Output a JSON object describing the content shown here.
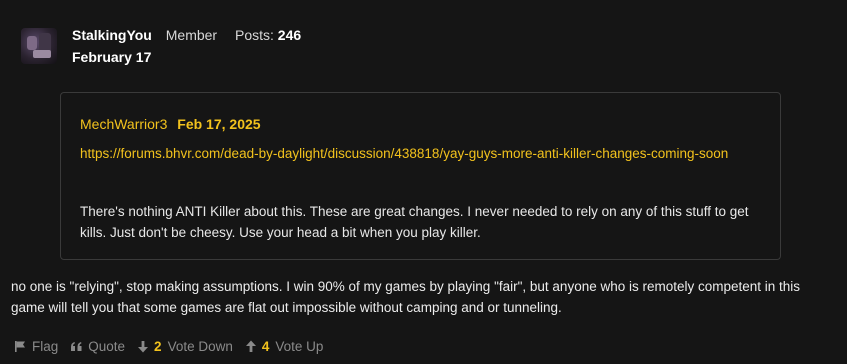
{
  "post": {
    "username": "StalkingYou",
    "role": "Member",
    "posts_label": "Posts:",
    "posts_count": "246",
    "date": "February 17"
  },
  "quote": {
    "author": "MechWarrior3",
    "date": "Feb 17, 2025",
    "link": "https://forums.bhvr.com/dead-by-daylight/discussion/438818/yay-guys-more-anti-killer-changes-coming-soon",
    "text": "There's nothing ANTI Killer about this. These are great changes. I never needed to rely on any of this stuff to get kills. Just don't be cheesy. Use your head a bit when you play killer."
  },
  "body": {
    "text": "no one is \"relying\", stop making assumptions. I win 90% of my games by playing \"fair\", but anyone who is remotely competent in this game will tell you that some games are flat out impossible without camping and or tunneling."
  },
  "actions": {
    "flag_label": "Flag",
    "quote_label": "Quote",
    "vote_down_count": "2",
    "vote_down_label": "Vote Down",
    "vote_up_count": "4",
    "vote_up_label": "Vote Up"
  },
  "colors": {
    "accent": "#f2c21d",
    "background": "#151515",
    "muted": "#8a8a8a"
  },
  "icons": [
    "avatar",
    "flag-icon",
    "quote-icon",
    "arrow-down-icon",
    "arrow-up-icon"
  ]
}
